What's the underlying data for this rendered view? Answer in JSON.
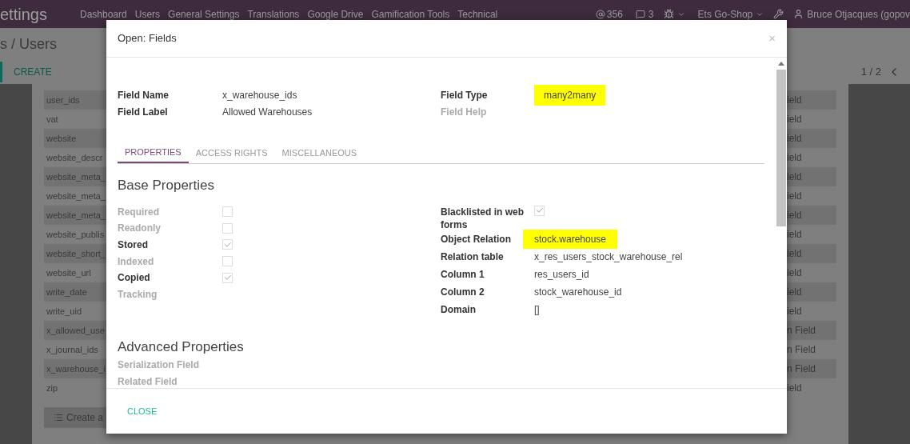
{
  "navbar": {
    "app_title": "ettings",
    "menu": [
      "Dashboard",
      "Users",
      "General Settings",
      "Translations",
      "Google Drive",
      "Gamification Tools",
      "Technical"
    ],
    "mentions": "356",
    "messages": "3",
    "company": "Ets Go-Shop",
    "user": "Bruce Otjacques (gopov"
  },
  "breadcrumb": "s / Users",
  "create_button": "CREATE",
  "pager": "1 / 2",
  "rows": [
    {
      "left": "user_ids",
      "right": "ield"
    },
    {
      "left": "vat",
      "right": "ield"
    },
    {
      "left": "website",
      "right": "ield"
    },
    {
      "left": "website_descr",
      "right": "ield"
    },
    {
      "left": "website_meta_",
      "right": "ield"
    },
    {
      "left": "website_meta_",
      "right": "ield"
    },
    {
      "left": "website_meta_",
      "right": "ield"
    },
    {
      "left": "website_publis",
      "right": "ield"
    },
    {
      "left": "website_short_",
      "right": "ield"
    },
    {
      "left": "website_url",
      "right": "ield"
    },
    {
      "left": "write_date",
      "right": "ield"
    },
    {
      "left": "write_uid",
      "right": "ield"
    },
    {
      "left": "x_allowed_use",
      "right": "n Field"
    },
    {
      "left": "x_journal_ids",
      "right": "n Field"
    },
    {
      "left": "x_warehouse_i",
      "right": "n Field"
    },
    {
      "left": "zip",
      "right": "ield"
    }
  ],
  "create_line_button": "Create a",
  "dialog": {
    "title": "Open: Fields",
    "close_x": "×",
    "header_left": [
      {
        "label": "Field Name",
        "value": "x_warehouse_ids"
      },
      {
        "label": "Field Label",
        "value": "Allowed Warehouses"
      }
    ],
    "header_right": [
      {
        "label": "Field Type",
        "value": "many2many",
        "highlighted": true,
        "muted": false
      },
      {
        "label": "Field Help",
        "muted": true
      }
    ],
    "tabs": [
      {
        "label": "PROPERTIES",
        "selected": true
      },
      {
        "label": "ACCESS RIGHTS",
        "selected": false
      },
      {
        "label": "MISCELLANEOUS",
        "selected": false
      }
    ],
    "base_title": "Base Properties",
    "base_left": [
      {
        "label": "Required",
        "kind": "checkbox",
        "checked": false,
        "muted": true
      },
      {
        "label": "Readonly",
        "kind": "checkbox",
        "checked": false,
        "muted": true
      },
      {
        "label": "Stored",
        "kind": "checkbox",
        "checked": true,
        "muted": false
      },
      {
        "label": "Indexed",
        "kind": "checkbox",
        "checked": false,
        "muted": true
      },
      {
        "label": "Copied",
        "kind": "checkbox",
        "checked": true,
        "muted": false
      },
      {
        "label": "Tracking",
        "kind": "empty",
        "muted": true
      }
    ],
    "base_right": [
      {
        "label": "Blacklisted in web forms",
        "kind": "checkbox",
        "checked": true
      },
      {
        "label": "Object Relation",
        "kind": "text",
        "value": "stock.warehouse",
        "highlighted": true
      },
      {
        "label": "Relation table",
        "kind": "text",
        "value": "x_res_users_stock_warehouse_rel",
        "highlighted": false
      },
      {
        "label": "Column 1",
        "kind": "text",
        "value": "res_users_id",
        "highlighted": false
      },
      {
        "label": "Column 2",
        "kind": "text",
        "value": "stock_warehouse_id",
        "highlighted": false
      },
      {
        "label": "Domain",
        "kind": "text",
        "value": "[]",
        "highlighted": false
      }
    ],
    "advanced_title": "Advanced Properties",
    "advanced": [
      "Serialization Field",
      "Related Field"
    ],
    "close_button": "CLOSE"
  }
}
